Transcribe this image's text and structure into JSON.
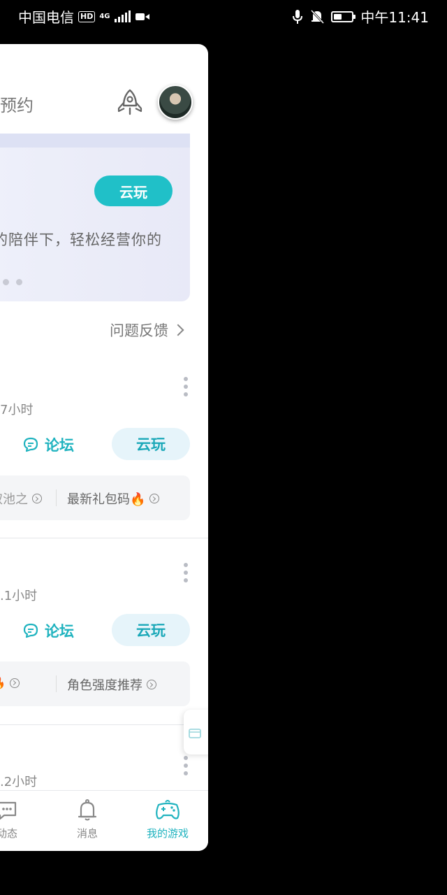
{
  "status_bar": {
    "carrier": "中国电信",
    "hd_badge": "HD",
    "network": "4G",
    "time": "中午11:41",
    "battery_level": 0.45
  },
  "header": {
    "label_partial": "预约",
    "icons": [
      "rocket-icon",
      "avatar"
    ]
  },
  "banner": {
    "cloud_button": "云玩",
    "description_partial": "的陪伴下，轻松经营你的",
    "accent_color": "#20c0c8"
  },
  "feedback": {
    "label": "问题反馈"
  },
  "games": [
    {
      "hours_partial": "7小时",
      "forum_label": "论坛",
      "cloud_label": "云玩",
      "tags": [
        "取池之",
        "最新礼包码🔥"
      ]
    },
    {
      "hours_partial": ".1小时",
      "forum_label": "论坛",
      "cloud_label": "云玩",
      "tags": [
        "🔥",
        "角色强度推荐"
      ]
    },
    {
      "hours_partial": ".2小时"
    }
  ],
  "bottom_nav": {
    "items": [
      {
        "label": "动态",
        "icon": "chat-icon"
      },
      {
        "label": "消息",
        "icon": "bell-icon"
      },
      {
        "label": "我的游戏",
        "icon": "gamepad-icon",
        "active": true
      }
    ],
    "active_color": "#20b3bf"
  }
}
